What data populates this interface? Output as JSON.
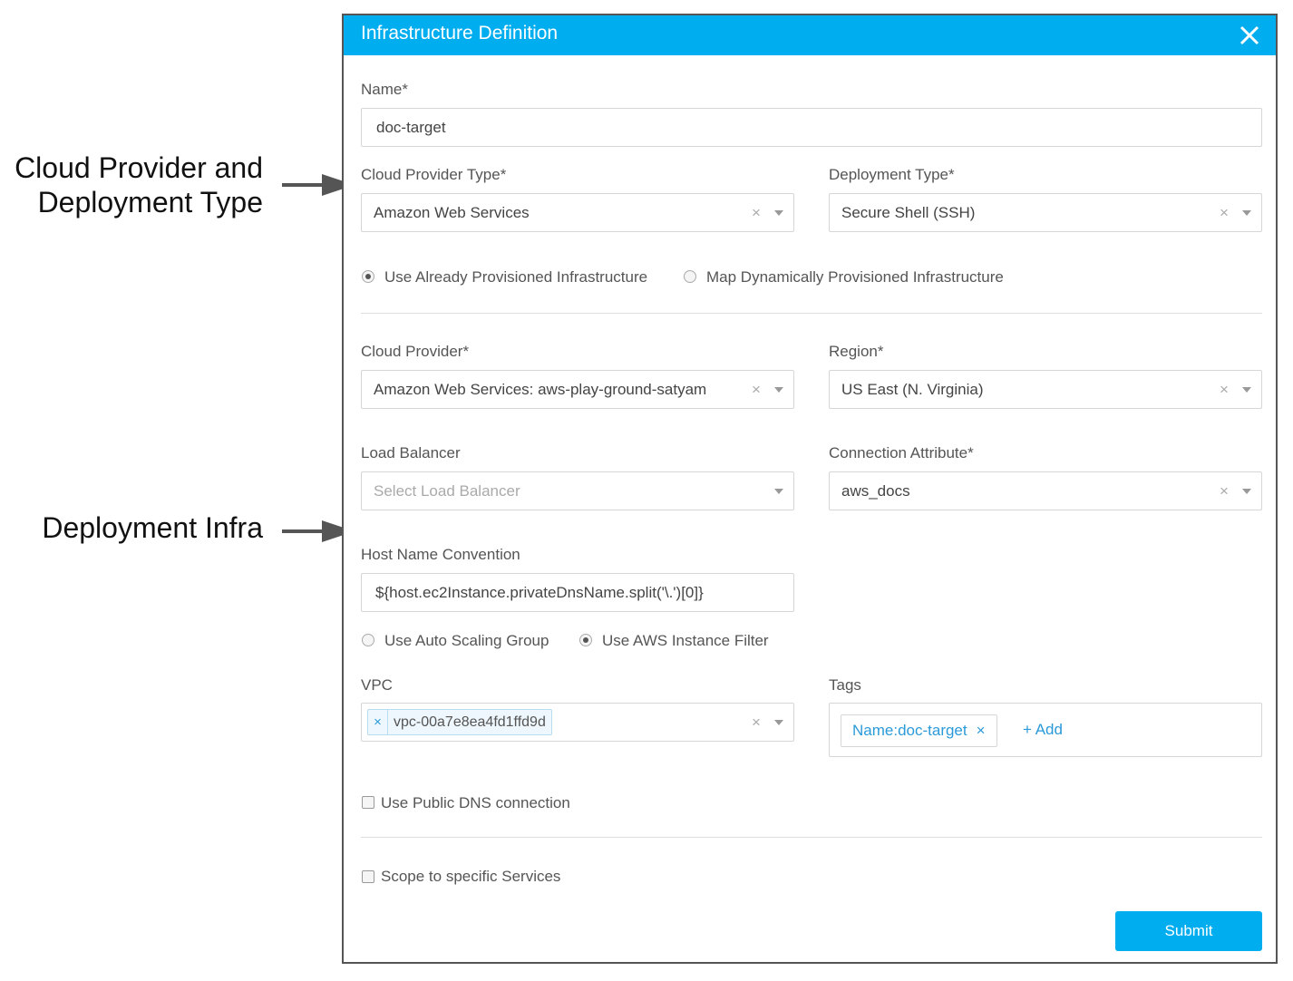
{
  "annotations": {
    "cloud_provider_line1": "Cloud Provider and",
    "cloud_provider_line2": "Deployment Type",
    "deployment_infra": "Deployment Infra"
  },
  "dialog": {
    "title": "Infrastructure Definition",
    "close_icon": "close-icon",
    "accent_color": "#00adef"
  },
  "form": {
    "name": {
      "label": "Name*",
      "value": "doc-target"
    },
    "cloud_provider_type": {
      "label": "Cloud Provider Type*",
      "value": "Amazon Web Services"
    },
    "deployment_type": {
      "label": "Deployment Type*",
      "value": "Secure Shell (SSH)"
    },
    "provision_options": [
      {
        "label": "Use Already Provisioned Infrastructure",
        "selected": true
      },
      {
        "label": "Map Dynamically Provisioned Infrastructure",
        "selected": false
      }
    ],
    "cloud_provider": {
      "label": "Cloud Provider*",
      "value": "Amazon Web Services: aws-play-ground-satyam"
    },
    "region": {
      "label": "Region*",
      "value": "US East (N. Virginia)"
    },
    "load_balancer": {
      "label": "Load Balancer",
      "placeholder": "Select Load Balancer"
    },
    "connection_attribute": {
      "label": "Connection Attribute*",
      "value": "aws_docs"
    },
    "host_name_convention": {
      "label": "Host Name Convention",
      "value": "${host.ec2Instance.privateDnsName.split('\\.')[0]}"
    },
    "instance_options": [
      {
        "label": "Use Auto Scaling Group",
        "selected": false
      },
      {
        "label": "Use AWS Instance Filter",
        "selected": true
      }
    ],
    "vpc": {
      "label": "VPC",
      "chip_remove": "×",
      "value": "vpc-00a7e8ea4fd1ffd9d"
    },
    "tags": {
      "label": "Tags",
      "tag_value": "Name:doc-target",
      "tag_remove": "×",
      "add_label": "+ Add"
    },
    "public_dns": {
      "label": "Use Public DNS connection",
      "checked": false
    },
    "scope_services": {
      "label": "Scope to specific Services",
      "checked": false
    },
    "submit_label": "Submit",
    "clear_glyph": "×"
  }
}
